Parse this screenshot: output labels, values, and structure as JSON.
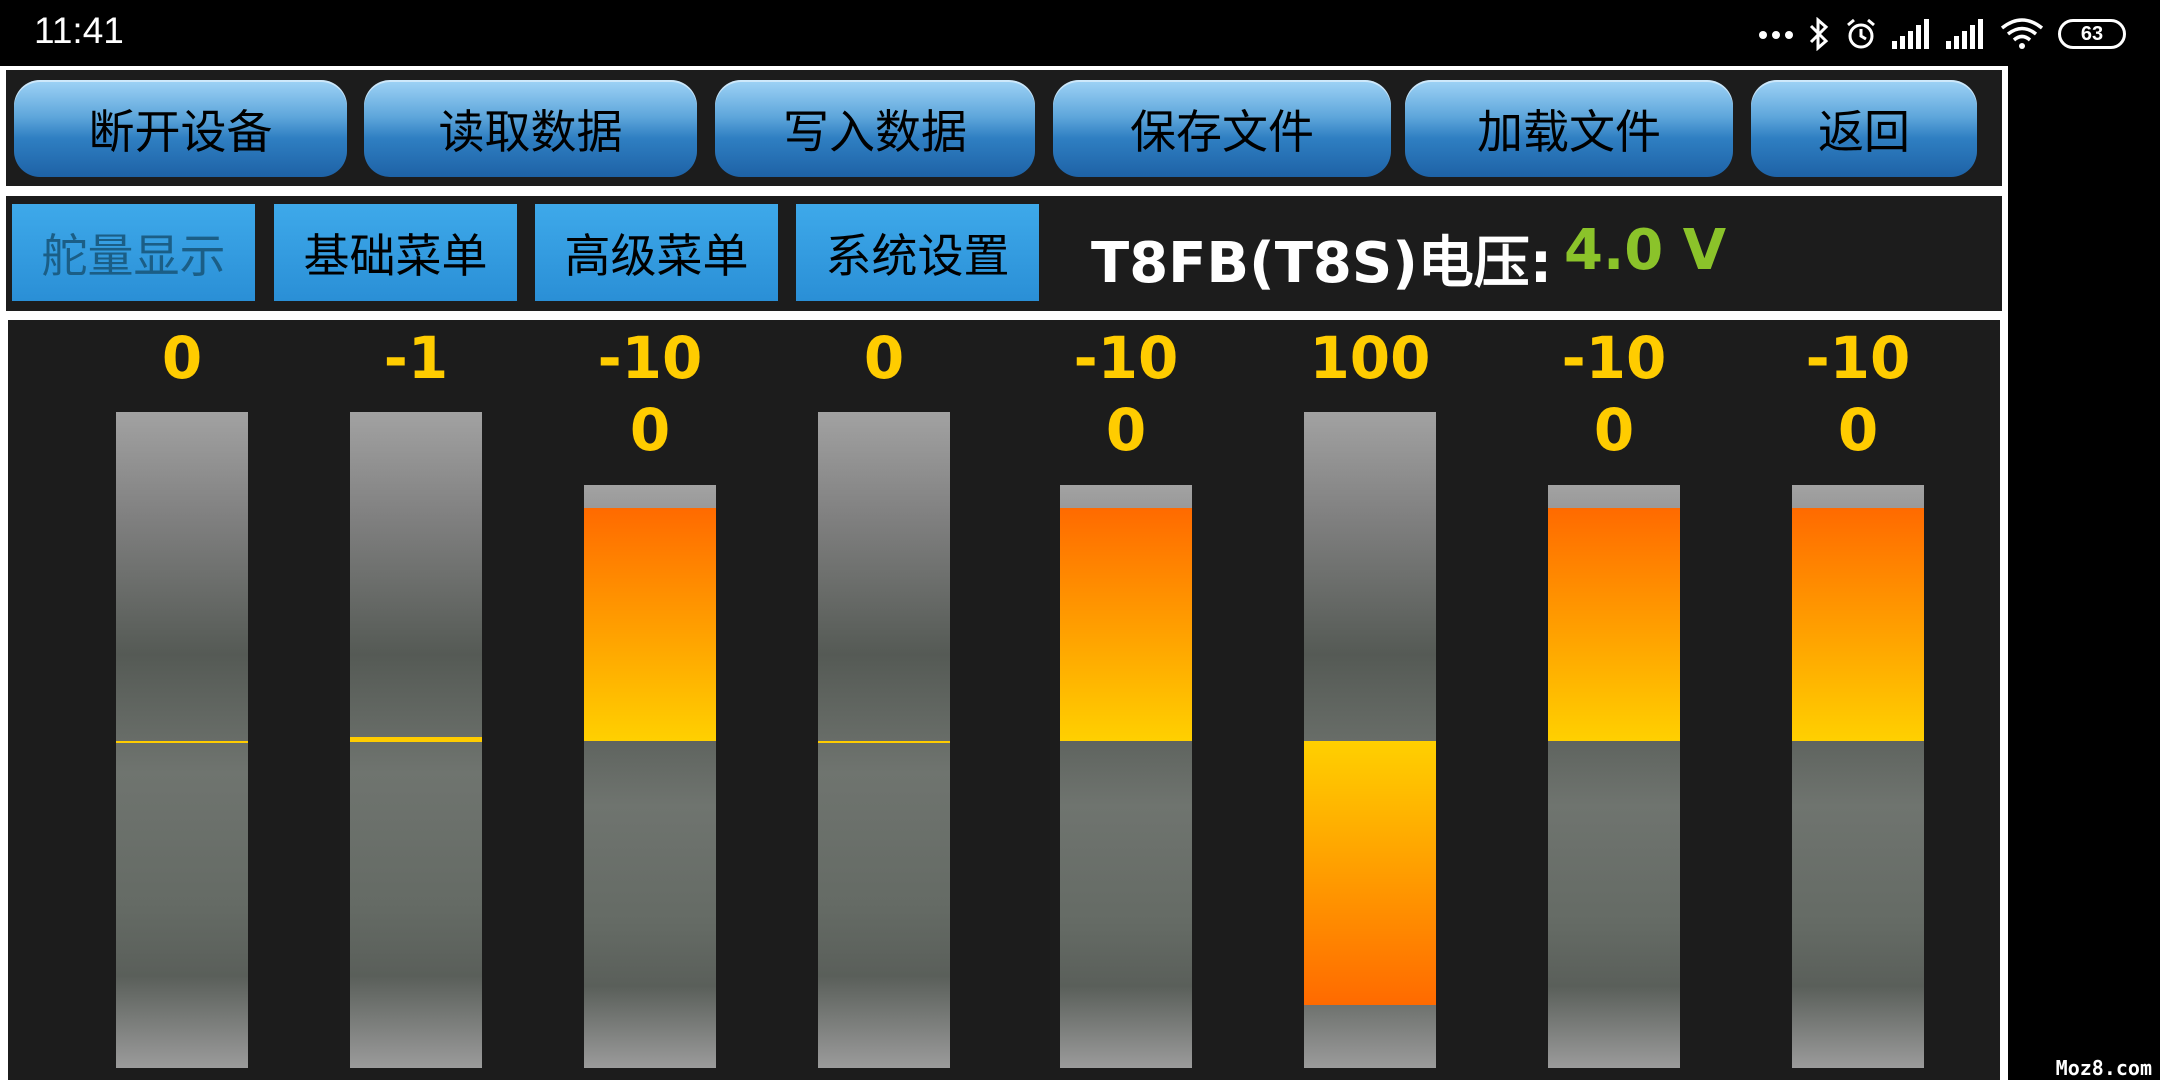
{
  "status_bar": {
    "time": "11:41",
    "battery": "63",
    "icons": [
      "more-dots-icon",
      "bluetooth-icon",
      "alarm-icon",
      "signal-icon",
      "signal-icon",
      "wifi-icon",
      "battery-icon"
    ]
  },
  "toolbar": {
    "buttons": [
      "断开设备",
      "读取数据",
      "写入数据",
      "保存文件",
      "加载文件",
      "返回"
    ]
  },
  "tabs": {
    "items": [
      "舵量显示",
      "基础菜单",
      "高级菜单",
      "系统设置"
    ],
    "active_index": 0
  },
  "voltage": {
    "label": "T8FB(T8S)电压:",
    "value": "4.0 V",
    "value_color": "#8bc32a"
  },
  "channels": {
    "value_color": "#ffcc00",
    "fill_colors": [
      "#ff6a00",
      "#ffd000"
    ],
    "range": [
      -100,
      100
    ],
    "items": [
      {
        "value": 0
      },
      {
        "value": -1
      },
      {
        "value": -100
      },
      {
        "value": 0
      },
      {
        "value": -100
      },
      {
        "value": 100
      },
      {
        "value": -100
      },
      {
        "value": -100
      }
    ]
  },
  "watermark": "Moz8.com"
}
